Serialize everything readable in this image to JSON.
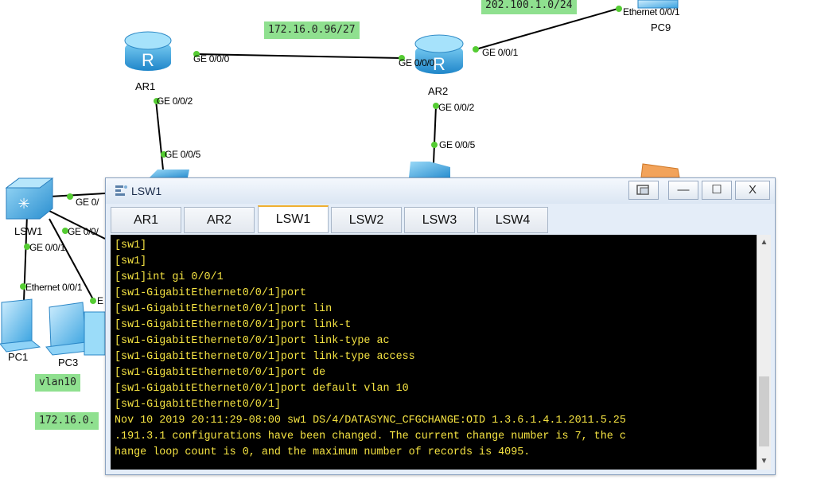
{
  "topology": {
    "networks": [
      {
        "id": "net-172-96",
        "text": "172.16.0.96/27"
      },
      {
        "id": "net-202",
        "text": "202.100.1.0/24"
      },
      {
        "id": "vlan10",
        "text": "vlan10"
      },
      {
        "id": "net-172-partial",
        "text": "172.16.0."
      }
    ],
    "devices": [
      {
        "id": "ar1",
        "name": "AR1",
        "icon": "router-icon"
      },
      {
        "id": "ar2",
        "name": "AR2",
        "icon": "router-icon"
      },
      {
        "id": "lsw1",
        "name": "LSW1",
        "icon": "switch-icon"
      },
      {
        "id": "pc1",
        "name": "PC1",
        "icon": "pc-icon"
      },
      {
        "id": "pc3",
        "name": "PC3",
        "icon": "pc-icon"
      },
      {
        "id": "pc9",
        "name": "PC9",
        "icon": "pc-icon"
      }
    ],
    "ports": [
      "GE 0/0/0",
      "GE 0/0/0",
      "GE 0/0/1",
      "GE 0/0/2",
      "GE 0/0/2",
      "GE 0/0/5",
      "GE 0/0/5",
      "Ethernet 0/0/1",
      "GE 0/",
      "GE 0/0/",
      "GE 0/0/1",
      "Ethernet 0/0/1",
      "E"
    ]
  },
  "window": {
    "title": "LSW1",
    "icon": "terminal-app-icon",
    "buttons": {
      "restore": "restore-icon",
      "minimize": "—",
      "maximize": "☐",
      "close": "X"
    },
    "tabs": [
      "AR1",
      "AR2",
      "LSW1",
      "LSW2",
      "LSW3",
      "LSW4"
    ],
    "active_tab": "LSW1"
  },
  "terminal": {
    "lines": [
      "[sw1]",
      "[sw1]",
      "[sw1]int gi 0/0/1",
      "[sw1-GigabitEthernet0/0/1]port",
      "[sw1-GigabitEthernet0/0/1]port lin",
      "[sw1-GigabitEthernet0/0/1]port link-t",
      "[sw1-GigabitEthernet0/0/1]port link-type ac",
      "[sw1-GigabitEthernet0/0/1]port link-type access",
      "[sw1-GigabitEthernet0/0/1]port de",
      "[sw1-GigabitEthernet0/0/1]port default vlan 10",
      "[sw1-GigabitEthernet0/0/1]",
      "Nov 10 2019 20:11:29-08:00 sw1 DS/4/DATASYNC_CFGCHANGE:OID 1.3.6.1.4.1.2011.5.25",
      ".191.3.1 configurations have been changed. The current change number is 7, the c",
      "hange loop count is 0, and the maximum number of records is 4095."
    ]
  }
}
